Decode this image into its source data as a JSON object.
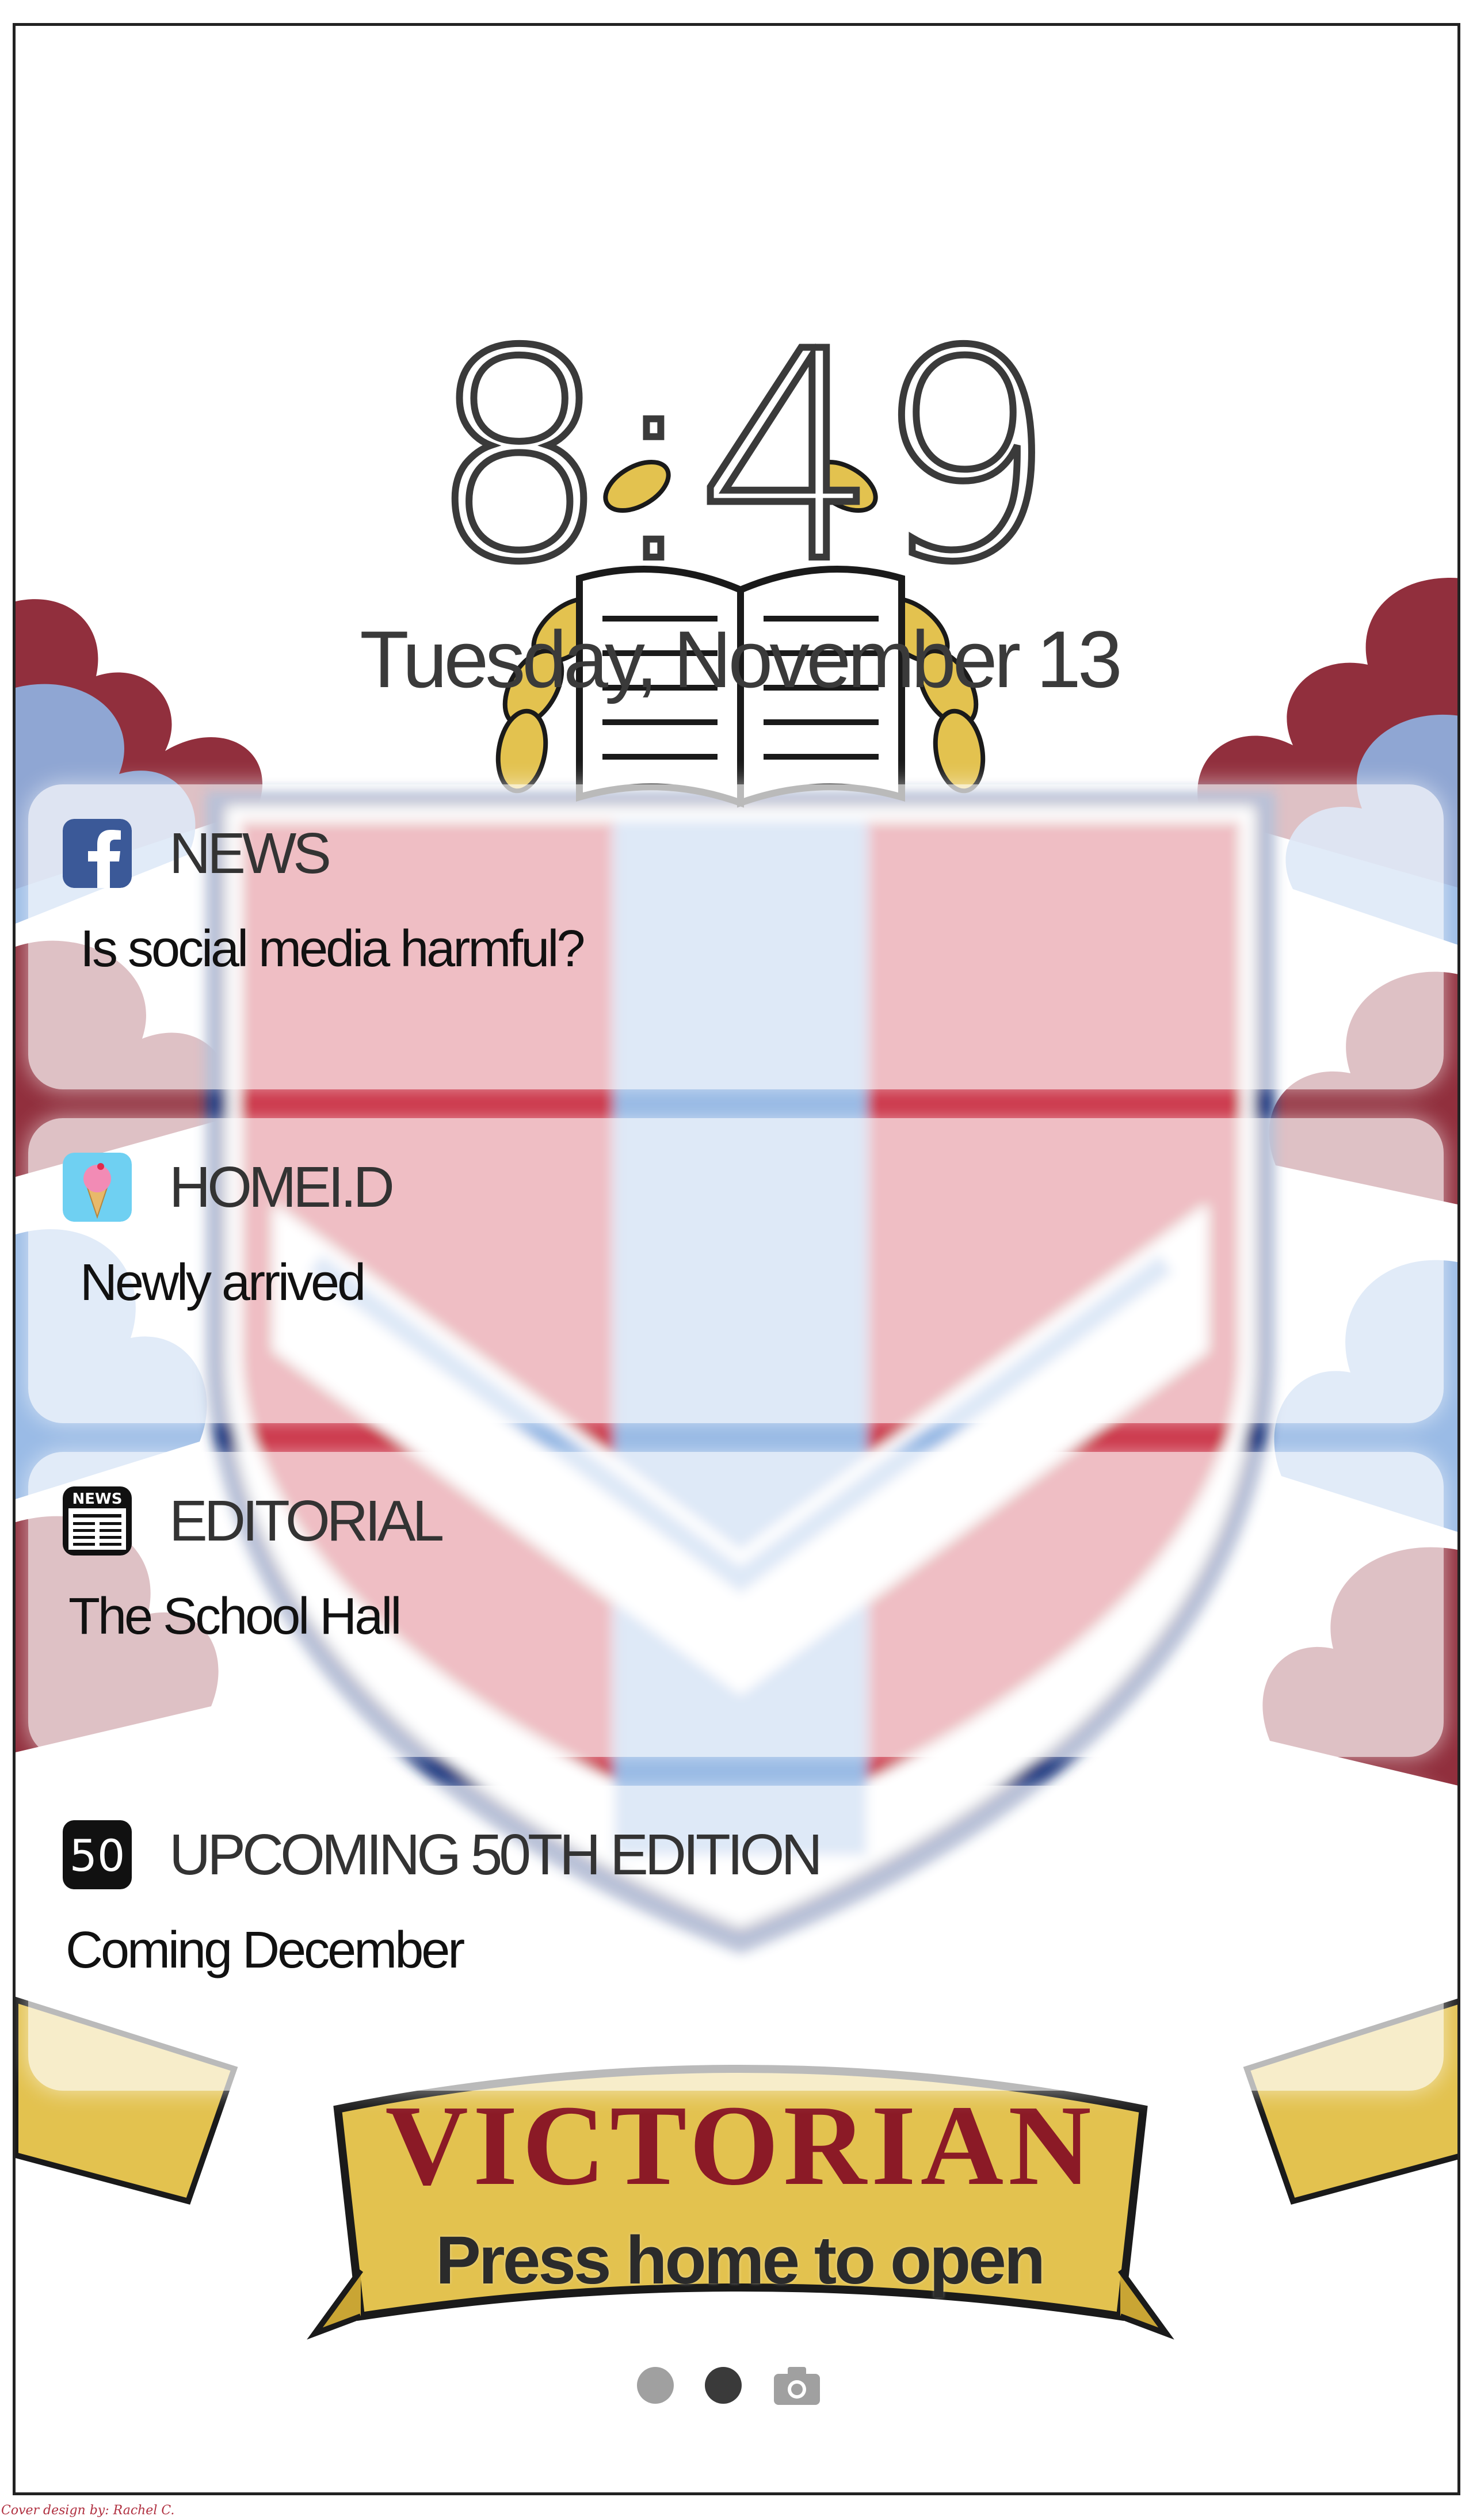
{
  "lock_screen": {
    "time": "8:49",
    "date": "Tuesday, November 13",
    "prompt": "Press home to open",
    "page_dots": [
      "dot",
      "dot-active",
      "camera-icon"
    ]
  },
  "notifications": [
    {
      "app": "NEWS",
      "icon": "facebook-icon",
      "message": "Is social media harmful?"
    },
    {
      "app": "HOMEI.D",
      "icon": "ice-cream-icon",
      "message": "Newly arrived"
    },
    {
      "app": "EDITORIAL",
      "icon": "newspaper-icon",
      "icon_text": "NEWS",
      "message": "The School Hall"
    },
    {
      "app": "UPCOMING 50TH EDITION",
      "icon": "fifty-icon",
      "icon_text": "50",
      "message": "Coming December"
    }
  ],
  "wallpaper": {
    "banner_text": "VICTORIAN",
    "colors": {
      "maroon": "#8b2433",
      "light_blue": "#8fb4e3",
      "navy": "#14337a",
      "gold": "#e3c24f"
    }
  },
  "credit": "Cover design by: Rachel C."
}
